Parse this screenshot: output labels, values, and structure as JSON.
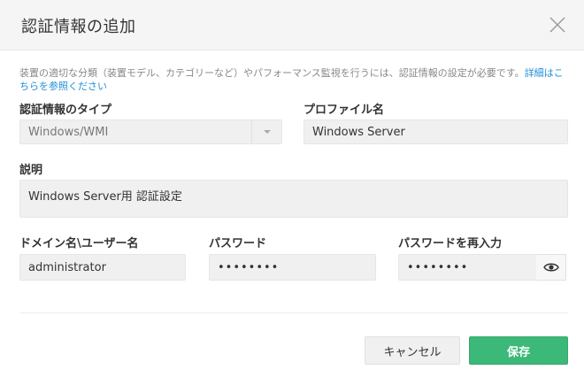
{
  "dialog": {
    "title": "認証情報の追加",
    "description": "装置の適切な分類（装置モデル、カテゴリーなど）やパフォーマンス監視を行うには、認証情報の設定が必要です。",
    "description_link": "詳細はこちらを参照ください"
  },
  "form": {
    "credential_type_label": "認証情報のタイプ",
    "credential_type_value": "Windows/WMI",
    "profile_name_label": "プロファイル名",
    "profile_name_value": "Windows Server",
    "description_label": "説明",
    "description_value": "Windows Server用 認証設定",
    "domain_user_label": "ドメイン名\\ユーザー名",
    "domain_user_value": "administrator",
    "password_label": "パスワード",
    "password_value": "••••••••",
    "password_confirm_label": "パスワードを再入力",
    "password_confirm_value": "••••••••"
  },
  "buttons": {
    "cancel": "キャンセル",
    "save": "保存"
  },
  "icons": {
    "close": "close-icon",
    "dropdown": "triangle-down-icon",
    "show_password": "eye-icon"
  },
  "colors": {
    "accent": "#3cb878",
    "link": "#1e90d6"
  }
}
